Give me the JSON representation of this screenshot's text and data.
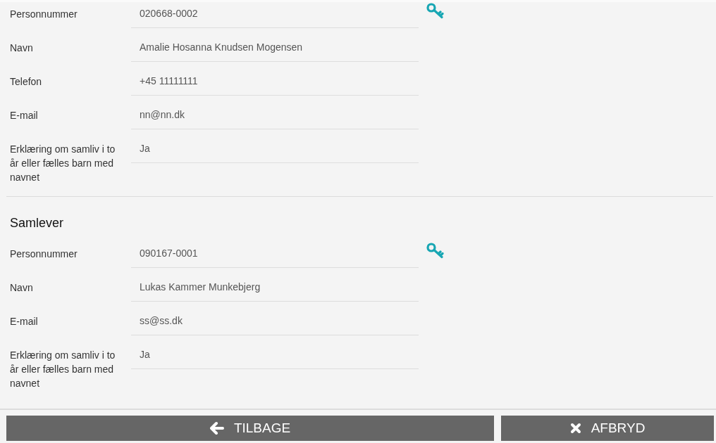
{
  "sections": [
    {
      "fields": [
        {
          "label": "Personnummer",
          "value": "020668-0002",
          "key": true
        },
        {
          "label": "Navn",
          "value": "Amalie Hosanna Knudsen Mogensen",
          "key": false
        },
        {
          "label": "Telefon",
          "value": "+45 11111111",
          "key": false
        },
        {
          "label": "E-mail",
          "value": "nn@nn.dk",
          "key": false
        },
        {
          "label": "Erklæring om samliv i to år eller fælles barn med navnet",
          "value": "Ja",
          "key": false
        }
      ]
    },
    {
      "title": "Samlever",
      "fields": [
        {
          "label": "Personnummer",
          "value": "090167-0001",
          "key": true
        },
        {
          "label": "Navn",
          "value": "Lukas Kammer Munkebjerg",
          "key": false
        },
        {
          "label": "E-mail",
          "value": "ss@ss.dk",
          "key": false
        },
        {
          "label": "Erklæring om samliv i to år eller fælles barn med navnet",
          "value": "Ja",
          "key": false
        }
      ]
    }
  ],
  "buttons": [
    {
      "kind": "back",
      "label": "TILBAGE"
    },
    {
      "kind": "cancel",
      "label": "AFBRYD"
    }
  ]
}
